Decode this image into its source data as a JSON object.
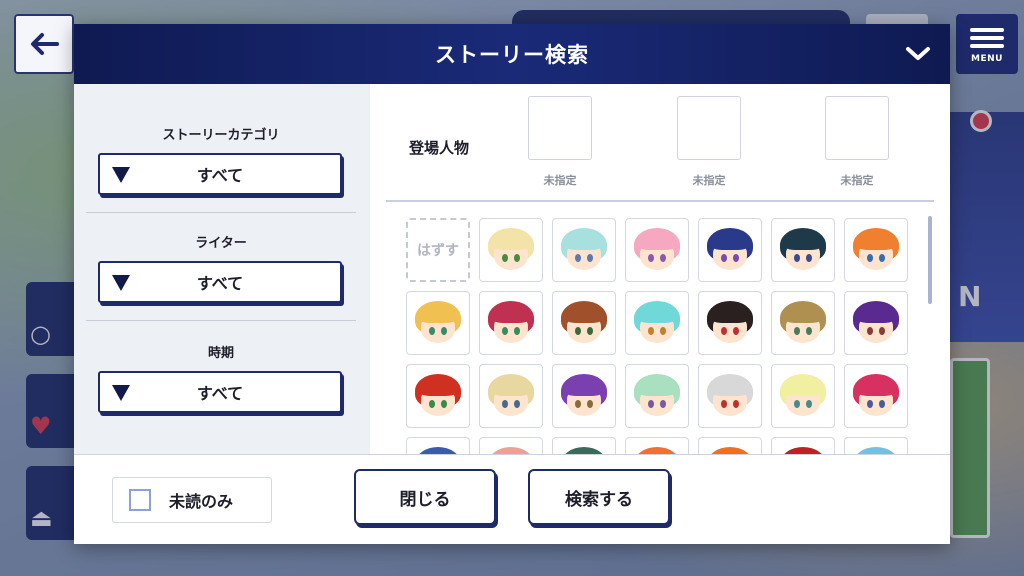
{
  "modal": {
    "title": "ストーリー検索"
  },
  "filters": [
    {
      "label": "ストーリーカテゴリ",
      "value": "すべて"
    },
    {
      "label": "ライター",
      "value": "すべて"
    },
    {
      "label": "時期",
      "value": "すべて"
    }
  ],
  "characters": {
    "label": "登場人物",
    "slots": [
      "未指定",
      "未指定",
      "未指定"
    ],
    "clear_label": "はずす",
    "icons": [
      {
        "hair": "#f3e3a8",
        "eye": "#4a8a3a"
      },
      {
        "hair": "#a8e0e0",
        "eye": "#5a7ab0"
      },
      {
        "hair": "#f5a8c0",
        "eye": "#8a5ab0"
      },
      {
        "hair": "#2a3a8a",
        "eye": "#7a4ab0"
      },
      {
        "hair": "#1e3a4a",
        "eye": "#3a4a8a"
      },
      {
        "hair": "#f08030",
        "eye": "#3a6ab0"
      },
      {
        "hair": "#f0c050",
        "eye": "#3a8a6a"
      },
      {
        "hair": "#c03050",
        "eye": "#3a8a5a"
      },
      {
        "hair": "#a0502a",
        "eye": "#3a6a3a"
      },
      {
        "hair": "#70d8d8",
        "eye": "#c08030"
      },
      {
        "hair": "#2a2020",
        "eye": "#c03030"
      },
      {
        "hair": "#b09050",
        "eye": "#4a7a5a"
      },
      {
        "hair": "#5a2a90",
        "eye": "#8a3a3a"
      },
      {
        "hair": "#d03020",
        "eye": "#3a8a4a"
      },
      {
        "hair": "#e8d8a0",
        "eye": "#4a6a8a"
      },
      {
        "hair": "#7a40b0",
        "eye": "#8a6a3a"
      },
      {
        "hair": "#a8e0c0",
        "eye": "#7a5a9a"
      },
      {
        "hair": "#d8d8d8",
        "eye": "#c0302a"
      },
      {
        "hair": "#f0f0a0",
        "eye": "#4a8a8a"
      },
      {
        "hair": "#d83060",
        "eye": "#4a5a9a"
      },
      {
        "hair": "#3a5ab0",
        "eye": "#3a3a3a"
      },
      {
        "hair": "#f0a090",
        "eye": "#3a3a3a"
      },
      {
        "hair": "#3a6a5a",
        "eye": "#3a3a3a"
      },
      {
        "hair": "#f07030",
        "eye": "#3a3a3a"
      },
      {
        "hair": "#f07020",
        "eye": "#3a3a3a"
      },
      {
        "hair": "#c02020",
        "eye": "#3a3a3a"
      },
      {
        "hair": "#70c0e8",
        "eye": "#3a3a3a"
      }
    ]
  },
  "footer": {
    "unread_only": "未読のみ",
    "close": "閉じる",
    "search": "検索する"
  },
  "menu": {
    "label": "MENU"
  }
}
